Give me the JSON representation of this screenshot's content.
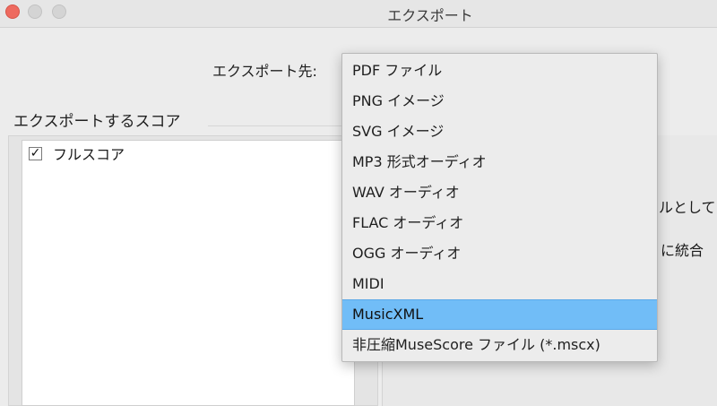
{
  "window": {
    "title": "エクスポート"
  },
  "export_destination": {
    "label": "エクスポート先:",
    "selected": "MusicXML",
    "options": [
      "PDF ファイル",
      "PNG イメージ",
      "SVG イメージ",
      "MP3 形式オーディオ",
      "WAV オーディオ",
      "FLAC オーディオ",
      "OGG オーディオ",
      "MIDI",
      "MusicXML",
      "非圧縮MuseScore ファイル (*.mscx)"
    ]
  },
  "scores_group": {
    "title": "エクスポートするスコア",
    "items": [
      {
        "label": "フルスコア",
        "checked": true
      }
    ]
  },
  "options_panel": {
    "partial_text_1": "ルとして",
    "partial_text_2": "に統合"
  }
}
